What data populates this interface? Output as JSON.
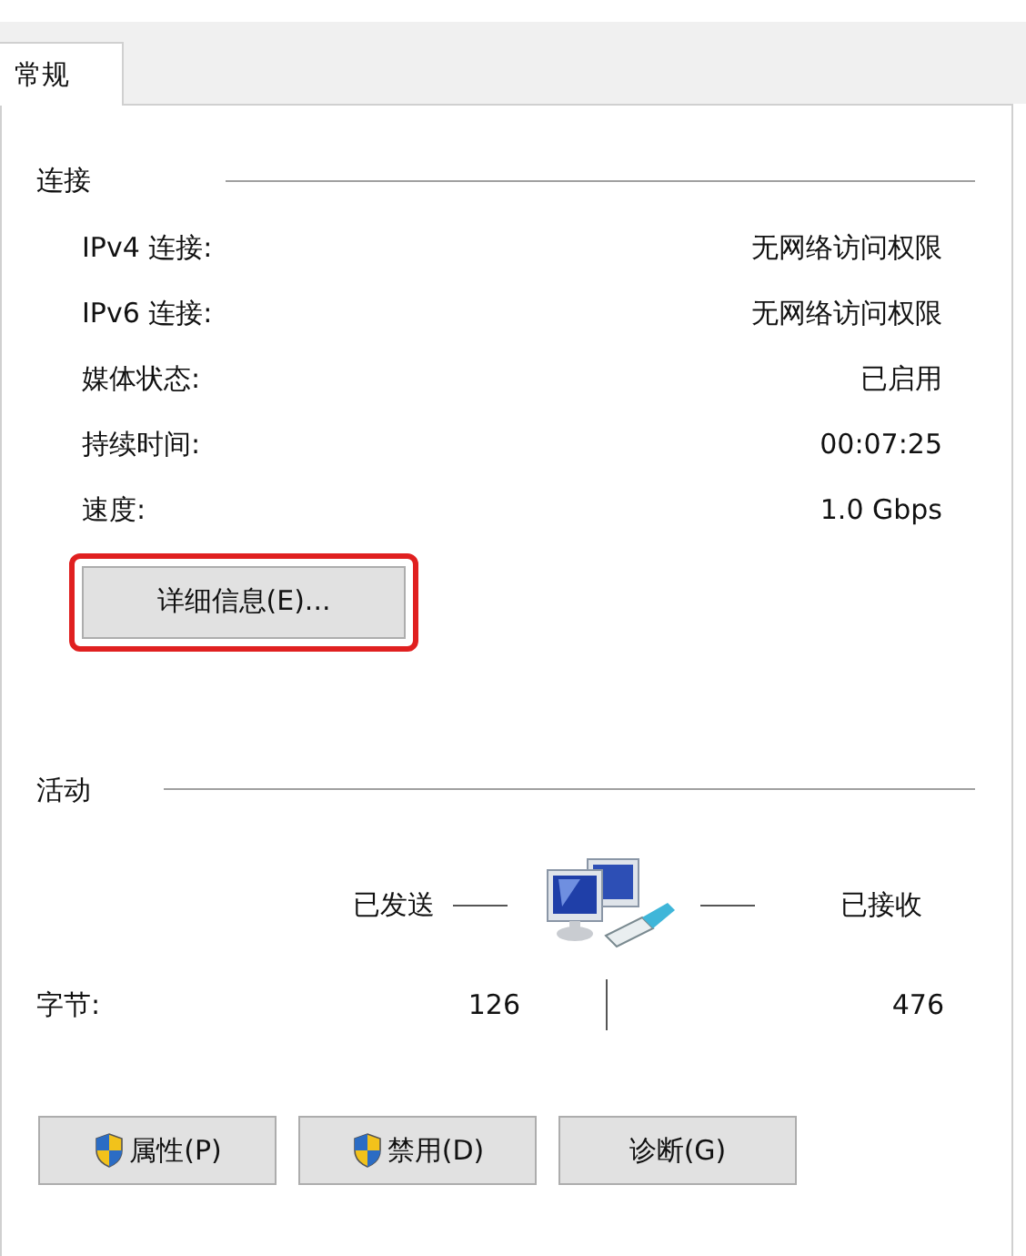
{
  "tabs": [
    {
      "label": "常规",
      "selected": true
    }
  ],
  "connection": {
    "title": "连接",
    "rows": [
      {
        "label": "IPv4 连接:",
        "value": "无网络访问权限"
      },
      {
        "label": "IPv6 连接:",
        "value": "无网络访问权限"
      },
      {
        "label": "媒体状态:",
        "value": "已启用"
      },
      {
        "label": "持续时间:",
        "value": "00:07:25"
      },
      {
        "label": "速度:",
        "value": "1.0 Gbps"
      }
    ],
    "details_button": {
      "label": "详细信息(E)...",
      "highlighted": true
    }
  },
  "activity": {
    "title": "活动",
    "sent_label": "已发送",
    "received_label": "已接收",
    "bytes_label": "字节:",
    "bytes_sent": "126",
    "bytes_received": "476"
  },
  "buttons": [
    {
      "label": "属性(P)",
      "shield": true
    },
    {
      "label": "禁用(D)",
      "shield": true
    },
    {
      "label": "诊断(G)",
      "shield": false
    }
  ]
}
